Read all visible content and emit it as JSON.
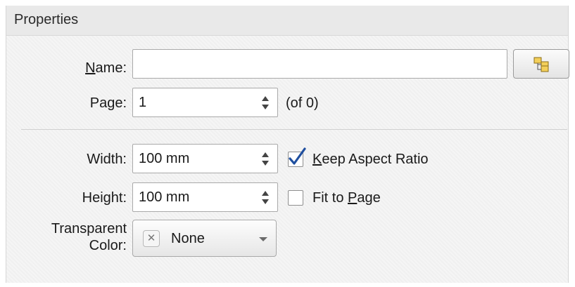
{
  "panel": {
    "title": "Properties"
  },
  "name_field": {
    "label_prefix": "",
    "label_mnemonic": "N",
    "label_rest": "ame:",
    "value": ""
  },
  "page_field": {
    "label": "Page:",
    "value": "1",
    "of_text": "(of 0)"
  },
  "width_field": {
    "label": "Width:",
    "value": "100 mm"
  },
  "height_field": {
    "label": "Height:",
    "value": "100 mm"
  },
  "keep_aspect": {
    "checked": true,
    "label_mnemonic": "K",
    "label_rest": "eep Aspect Ratio"
  },
  "fit_to_page": {
    "checked": false,
    "label_prefix": "Fit to ",
    "label_mnemonic": "P",
    "label_rest": "age"
  },
  "transparent_color": {
    "label_line1": "Transparent",
    "label_line2": "Color:",
    "value": "None",
    "swatch_icon": "x-icon"
  },
  "icons": {
    "browse": "tree-structure-icon",
    "check": "checkmark-icon"
  },
  "colors": {
    "check_mark": "#1f4f9f",
    "browse_icon_fill": "#f3cf5a"
  }
}
